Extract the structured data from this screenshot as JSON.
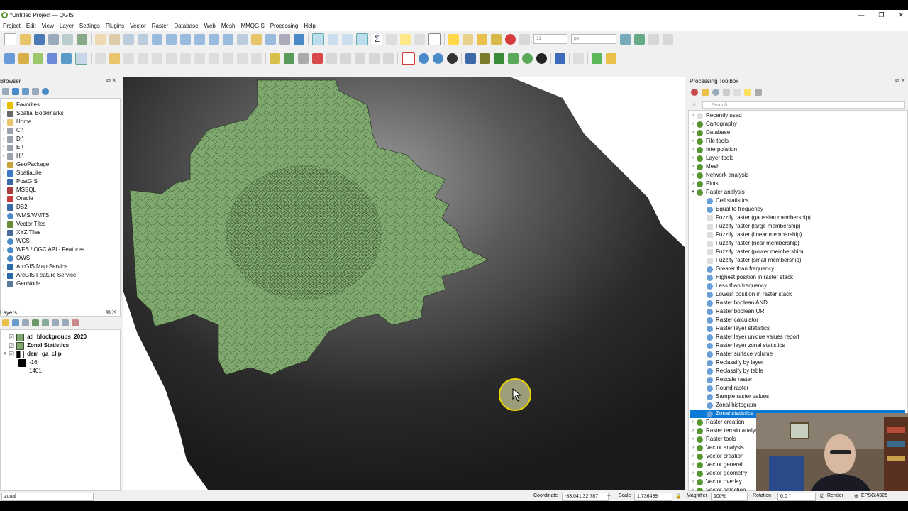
{
  "window": {
    "title": "*Untitled Project — QGIS",
    "controls": [
      "—",
      "❐",
      "✕"
    ]
  },
  "menus": [
    "Project",
    "Edit",
    "View",
    "Layer",
    "Settings",
    "Plugins",
    "Vector",
    "Raster",
    "Database",
    "Web",
    "Mesh",
    "MMQGIS",
    "Processing",
    "Help"
  ],
  "toolbar": {
    "font_size": "12",
    "unit": "px"
  },
  "browser": {
    "title": "Browser",
    "items": [
      {
        "label": "Favorites",
        "icon": "star-icon",
        "color": "#e8c000"
      },
      {
        "label": "Spatial Bookmarks",
        "icon": "bookmark-icon",
        "color": "#6a6a6a"
      },
      {
        "label": "Home",
        "icon": "folder-icon",
        "color": "#e8c46a"
      },
      {
        "label": "C:\\",
        "icon": "drive-icon",
        "color": "#9aa3ad"
      },
      {
        "label": "D:\\",
        "icon": "drive-icon",
        "color": "#9aa3ad"
      },
      {
        "label": "E:\\",
        "icon": "drive-icon",
        "color": "#9aa3ad"
      },
      {
        "label": "H:\\",
        "icon": "drive-icon",
        "color": "#9aa3ad"
      },
      {
        "label": "GeoPackage",
        "icon": "geopackage-icon",
        "color": "#c8a23c"
      },
      {
        "label": "SpatiaLite",
        "icon": "spatialite-icon",
        "color": "#3c7ac8"
      },
      {
        "label": "PostGIS",
        "icon": "postgis-icon",
        "color": "#3c6aa8"
      },
      {
        "label": "MSSQL",
        "icon": "mssql-icon",
        "color": "#a83c3c"
      },
      {
        "label": "Oracle",
        "icon": "oracle-icon",
        "color": "#c83c3c"
      },
      {
        "label": "DB2",
        "icon": "db2-icon",
        "color": "#3c6aa8"
      },
      {
        "label": "WMS/WMTS",
        "icon": "globe-icon",
        "color": "#4a8ac8"
      },
      {
        "label": "Vector Tiles",
        "icon": "vector-tiles-icon",
        "color": "#6a8a3c"
      },
      {
        "label": "XYZ Tiles",
        "icon": "grid-icon",
        "color": "#4a6a9a"
      },
      {
        "label": "WCS",
        "icon": "globe-icon",
        "color": "#4a8ac8"
      },
      {
        "label": "WFS / OGC API - Features",
        "icon": "globe-icon",
        "color": "#4a8ac8"
      },
      {
        "label": "OWS",
        "icon": "globe-icon",
        "color": "#4a8ac8"
      },
      {
        "label": "ArcGIS Map Service",
        "icon": "arcgis-icon",
        "color": "#2a6aa8"
      },
      {
        "label": "ArcGIS Feature Service",
        "icon": "arcgis-icon",
        "color": "#2a6aa8"
      },
      {
        "label": "GeoNode",
        "icon": "geonode-icon",
        "color": "#5a7a9a"
      }
    ]
  },
  "layers": {
    "title": "Layers",
    "items": [
      {
        "label": "atl_blockgroups_2020",
        "checked": true,
        "swatch": "#7fa86e"
      },
      {
        "label": "Zonal Statistics",
        "checked": true,
        "swatch": "#7fa86e"
      },
      {
        "label": "dem_ga_clip",
        "checked": true,
        "swatch": "raster"
      }
    ],
    "legend": [
      {
        "label": "-16",
        "swatch": "#000000"
      },
      {
        "label": "1401",
        "swatch": "#ffffff"
      }
    ]
  },
  "locator": {
    "value": "zonal"
  },
  "toolbox": {
    "title": "Processing Toolbox",
    "search_placeholder": "Search...",
    "groups_before": [
      "Recently used",
      "Cartography",
      "Database",
      "File tools",
      "Interpolation",
      "Layer tools",
      "Mesh",
      "Network analysis",
      "Plots"
    ],
    "expanded_group": "Raster analysis",
    "tools": [
      "Cell statistics",
      "Equal to frequency",
      "Fuzzify raster (gaussian membership)",
      "Fuzzify raster (large membership)",
      "Fuzzify raster (linear membership)",
      "Fuzzify raster (near membership)",
      "Fuzzify raster (power membership)",
      "Fuzzify raster (small membership)",
      "Greater than frequency",
      "Highest position in raster stack",
      "Less than frequency",
      "Lowest position in raster stack",
      "Raster boolean AND",
      "Raster boolean OR",
      "Raster calculator",
      "Raster layer statistics",
      "Raster layer unique values report",
      "Raster layer zonal statistics",
      "Raster surface volume",
      "Reclassify by layer",
      "Reclassify by table",
      "Rescale raster",
      "Round raster",
      "Sample raster values",
      "Zonal histogram",
      "Zonal statistics"
    ],
    "selected_tool": "Zonal statistics",
    "groups_after": [
      "Raster creation",
      "Raster terrain analysis",
      "Raster tools",
      "Vector analysis",
      "Vector creation",
      "Vector general",
      "Vector geometry",
      "Vector overlay",
      "Vector selection"
    ]
  },
  "status": {
    "coordinate_label": "Coordinate",
    "coordinate": "-83.041,32.787",
    "scale_label": "Scale",
    "scale": "1:736499",
    "magnifier_label": "Magnifier",
    "magnifier": "100%",
    "rotation_label": "Rotation",
    "rotation": "0.0 °",
    "render_label": "Render",
    "crs": "EPSG:4326"
  },
  "colors": {
    "accent": "#0a7ad4",
    "polygon_fill": "#7fa86e",
    "qgis_green": "#589632"
  }
}
